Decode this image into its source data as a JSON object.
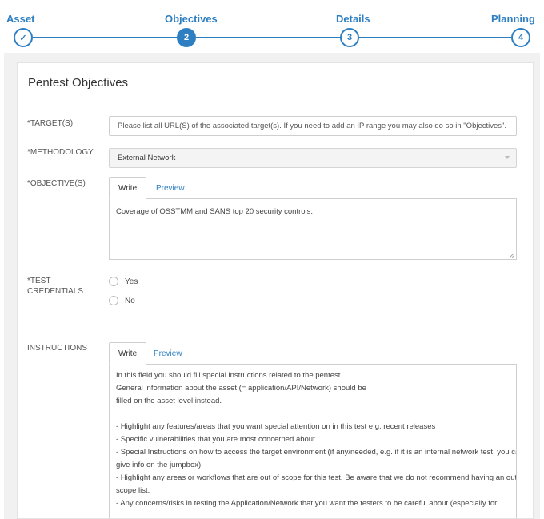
{
  "stepper": {
    "steps": [
      {
        "label": "Asset",
        "marker": "✓"
      },
      {
        "label": "Objectives",
        "marker": "2"
      },
      {
        "label": "Details",
        "marker": "3"
      },
      {
        "label": "Planning",
        "marker": "4"
      }
    ],
    "active_step": 2,
    "accent_color": "#2e7fc2"
  },
  "form": {
    "title": "Pentest Objectives",
    "target": {
      "label": "*TARGET(S)",
      "placeholder": "Please list all URL(S) of the associated target(s). If you need to add an IP range you may also do so in \"Objectives\"."
    },
    "methodology": {
      "label": "*METHODOLOGY",
      "selected": "External Network"
    },
    "objectives": {
      "label": "*OBJECTIVE(S)",
      "tab_write": "Write",
      "tab_preview": "Preview",
      "value": "Coverage of OSSTMM and SANS top 20 security controls."
    },
    "credentials": {
      "label_line1": "*TEST",
      "label_line2": "CREDENTIALS",
      "option_yes": "Yes",
      "option_no": "No"
    },
    "instructions": {
      "label": "INSTRUCTIONS",
      "tab_write": "Write",
      "tab_preview": "Preview",
      "lines": [
        "In this field you should fill special instructions related to the pentest.",
        "General information about the asset (= application/API/Network) should be",
        "filled on the asset level instead.",
        "",
        "- Highlight any features/areas that you want special attention on in this test e.g. recent releases",
        "- Specific vulnerabilities that you are most concerned about",
        "- Special Instructions on how to access the target environment (if any/needed, e.g. if it is an internal network test, you can",
        "give info on the jumpbox)",
        "- Highlight any areas or workflows that are out of scope for this test. Be aware that we do not recommend having an out of",
        "scope list.",
        "- Any concerns/risks in testing the Application/Network that you want the testers to be careful about (especially for"
      ]
    }
  }
}
